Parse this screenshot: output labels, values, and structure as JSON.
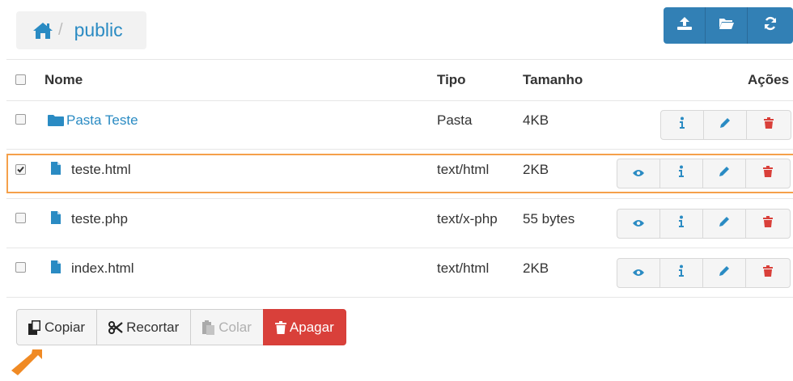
{
  "breadcrumb": {
    "separator": "/",
    "current": "public"
  },
  "toolbar": {
    "buttons": [
      "upload-icon",
      "folder-open-icon",
      "refresh-icon"
    ],
    "color": "#3280b5"
  },
  "table": {
    "headers": {
      "name": "Nome",
      "type": "Tipo",
      "size": "Tamanho",
      "actions": "Ações"
    },
    "rows": [
      {
        "name": "Pasta Teste",
        "type": "Pasta",
        "size": "4KB",
        "kind": "folder",
        "checked": false
      },
      {
        "name": "teste.html",
        "type": "text/html",
        "size": "2KB",
        "kind": "file",
        "checked": true
      },
      {
        "name": "teste.php",
        "type": "text/x-php",
        "size": "55 bytes",
        "kind": "file",
        "checked": false
      },
      {
        "name": "index.html",
        "type": "text/html",
        "size": "2KB",
        "kind": "file",
        "checked": false
      }
    ]
  },
  "bottom": {
    "copy": "Copiar",
    "cut": "Recortar",
    "paste": "Colar",
    "delete": "Apagar"
  },
  "colors": {
    "link": "#2a8bc3",
    "danger": "#d9403a",
    "selection": "#f5a04a"
  }
}
